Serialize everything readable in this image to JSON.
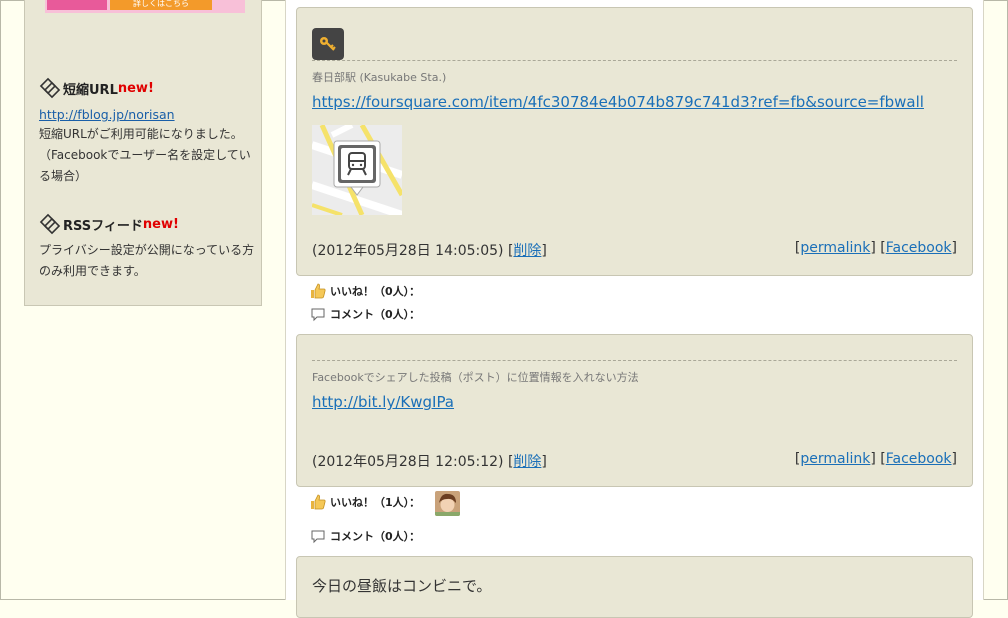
{
  "sidebar": {
    "banner": {
      "left_text": "",
      "button_text": "詳しくはこちら"
    },
    "short_url": {
      "title": "短縮URL",
      "badge": "new!",
      "link": "http://fblog.jp/norisan",
      "desc": "短縮URLがご利用可能になりました。（Facebookでユーザー名を設定している場合）"
    },
    "rss": {
      "title": "RSSフィード",
      "badge": "new!",
      "desc": "プライバシー設定が公開になっている方のみ利用できます。"
    }
  },
  "posts": [
    {
      "place": "春日部駅 (Kasukabe Sta.)",
      "link": "https://foursquare.com/item/4fc30784e4b074b879c741d3?ref=fb&source=fbwall",
      "time": "(2012年05月28日 14:05:05) [",
      "delete": "削除",
      "time_close": "]",
      "permalink": "permalink",
      "facebook": "Facebook",
      "like_label": "いいね！（0人）：",
      "comment_label": "コメント（0人）："
    },
    {
      "place": "Facebookでシェアした投稿（ポスト）に位置情報を入れない方法",
      "link": "http://bit.ly/KwgIPa",
      "time": "(2012年05月28日 12:05:12) [",
      "delete": "削除",
      "time_close": "]",
      "permalink": "permalink",
      "facebook": "Facebook",
      "like_label": "いいね！（1人）：",
      "comment_label": "コメント（0人）："
    },
    {
      "text": "今日の昼飯はコンビニで。"
    }
  ],
  "icons": {
    "place": "key-icon",
    "map": "train-station-map-icon",
    "like": "thumbs-up-icon",
    "comment": "speech-bubble-icon",
    "section": "diamond-logo-icon"
  },
  "colors": {
    "link": "#1a6fb8",
    "new_badge": "#e00000",
    "panel_bg": "#e9e7d5",
    "page_bg": "#fffff0"
  }
}
